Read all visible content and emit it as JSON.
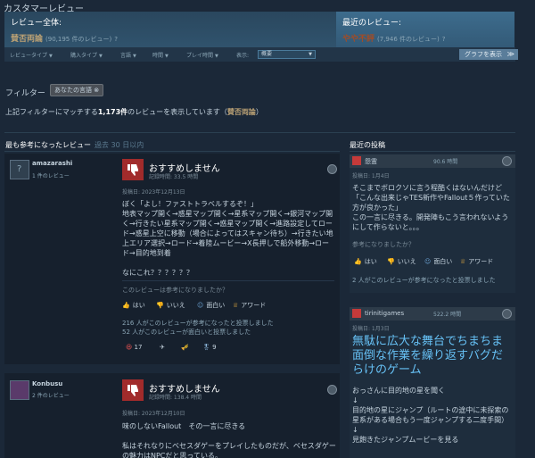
{
  "header": {
    "title": "カスタマーレビュー"
  },
  "summary": {
    "overall_label": "レビュー全体:",
    "overall_value": "賛否両論",
    "overall_count": "(90,195 件のレビュー)",
    "recent_label": "最近のレビュー:",
    "recent_value": "やや不評",
    "recent_count": "(7,946 件のレビュー)",
    "help_icon": "question-icon"
  },
  "filters": {
    "items": [
      "レビュータイプ",
      "購入タイプ",
      "言語",
      "時間",
      "プレイ時間"
    ],
    "display_label": "表示:",
    "display_value": "概要",
    "graph_button": "グラフを表示"
  },
  "filter_section": {
    "label": "フィルター",
    "chip": "あなたの言語",
    "chip_close": "⊗",
    "match_prefix": "上記フィルターにマッチする",
    "match_count": "1,173件",
    "match_suffix": "のレビューを表示しています（",
    "match_mixed": "賛否両論",
    "match_end": "）"
  },
  "most_helpful": {
    "title": "最も参考になったレビュー",
    "sub": "過去 30 日以内"
  },
  "recent_posts": {
    "title": "最近の投稿"
  },
  "reviews": [
    {
      "user": "amazarashi",
      "count": "1 件のレビュー",
      "verdict": "おすすめしません",
      "playtime": "記録時間: 33.5 時間",
      "posted": "投稿日: 2023年12月13日",
      "body": "ぼく「よし！ファストトラベルするぞ！」\n地表マップ開く→惑星マップ開く→星系マップ開く→銀河マップ開く→行きたい星系マップ開く→惑星マップ開く→進路設定してロード→惑星上空に移動（場合によってはスキャン待ち）→行きたい地上エリア選択→ロード→着陸ムービー→X長押しで船外移動→ロード→目的地到着\n\nなにこれ？？？？？？",
      "helpful_q": "このレビューは参考になりましたか？",
      "yes": "はい",
      "no": "いいえ",
      "funny": "面白い",
      "award": "アワード",
      "summary1": "216 人がこのレビューが参考になったと投票しました",
      "summary2": "52 人がこのレビューが面白いと投票しました",
      "award_count1": "17",
      "award_count2": "9"
    },
    {
      "user": "Konbusu",
      "count": "2 件のレビュー",
      "verdict": "おすすめしません",
      "playtime": "記録時間: 138.4 時間",
      "posted": "投稿日: 2023年12月10日",
      "body": "味のしないFallout　その一言に尽きる\n\n私はそれなりにベセスダゲーをプレイしたものだが、ベセスダゲーの魅力はNPCだと思っている。"
    }
  ],
  "sidebar": [
    {
      "user": "怨霊",
      "playtime": "90.6 時間",
      "posted": "投稿日: 1月4日",
      "body": "そこまでボロクソに言う程酷くはないんだけど「こんな出来じゃTES新作やFallout５作っていた方が良かった」\nこの一言に尽きる。開発陣もこう言われないようにして作らないと。。。",
      "helpful_q": "参考になりましたか？",
      "yes": "はい",
      "no": "いいえ",
      "funny": "面白い",
      "award": "アワード",
      "summary": "2 人がこのレビューが参考になったと投票しました"
    },
    {
      "user": "tirinitigames",
      "playtime": "522.2 時間",
      "posted": "投稿日: 1月3日",
      "big": "無駄に広大な舞台でちまちま面倒な作業を繰り返すバグだらけのゲーム",
      "body": "おっさんに目的地の星を聞く\n↓\n目的地の星にジャンプ（ルートの途中に未探索の星系がある場合もう一度ジャンプする二度手間）\n↓\n見飽きたジャンプムービーを見る"
    }
  ]
}
